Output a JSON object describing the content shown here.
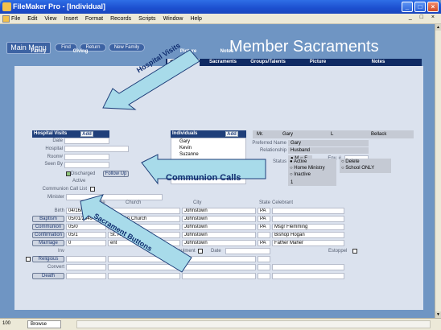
{
  "window": {
    "title": "FileMaker Pro - [Individual]",
    "min": "_",
    "max": "□",
    "close": "×"
  },
  "menubar": {
    "items": [
      "File",
      "Edit",
      "View",
      "Insert",
      "Format",
      "Records",
      "Scripts",
      "Window",
      "Help"
    ],
    "right_controls": "_ □ ×"
  },
  "toolbar": {
    "main_menu": "Main Menu",
    "find": "Find",
    "return": "Return",
    "new_family": "New Family"
  },
  "page_title": "Member Sacraments",
  "top_tabs": [
    "Family",
    "Giving",
    "Picture",
    "Notes"
  ],
  "sub_tabs": {
    "member": "< Member >",
    "sacraments": "Sacraments",
    "groups": "Groups/Talents",
    "picture": "Picture",
    "notes": "Notes"
  },
  "hospital": {
    "header": "Hospital Visits",
    "add": "Add",
    "labels": {
      "date": "Date",
      "hospital": "Hospital",
      "room": "Room#",
      "seen_by": "Seen By"
    },
    "discharged": "Discharged",
    "follow_up": "Follow Up",
    "status": "Active"
  },
  "individuals": {
    "header": "Individuals",
    "add": "Add",
    "names": [
      "Gary",
      "Kevin",
      "Suzanne"
    ]
  },
  "name_row": {
    "title": "Mr.",
    "first": "Gary",
    "middle": "L",
    "last": "Bellack"
  },
  "member_info": {
    "preferred_label": "Preferred Name",
    "preferred": "Gary",
    "relationship_label": "Relationship",
    "relationship": "Husband",
    "sex_m": "M",
    "sex_f": "F",
    "env_label": "Env. #"
  },
  "status": {
    "label": "Status",
    "options": [
      "Active",
      "Home Ministry",
      "Inactive",
      "Delete",
      "School ONLY"
    ],
    "value": "1"
  },
  "communion": {
    "call_list": "Communion Call List",
    "minister": "Minister"
  },
  "sacrament_columns": {
    "date": "Date",
    "church": "Church",
    "city": "City",
    "state": "State",
    "celebrant": "Celebrant"
  },
  "sacraments": [
    {
      "name": "Birth",
      "date": "04/16/1949",
      "church": "",
      "city": "Johnstown",
      "state": "PA",
      "celebrant": ""
    },
    {
      "name": "Baptism",
      "date": "05/01/2049",
      "church": "Visitation Church",
      "city": "Johnstown",
      "state": "PA",
      "celebrant": ""
    },
    {
      "name": "Communion",
      "date": "05/0",
      "church": "St. Andrew",
      "city": "Johnstown",
      "state": "PA",
      "celebrant": "Msgr Flemming"
    },
    {
      "name": "Confirmation",
      "date": "05/1",
      "church": "St. Andrew Church",
      "city": "Johnstown",
      "state": "",
      "celebrant": "Bishop Hogan"
    },
    {
      "name": "Marriage",
      "date": "0",
      "church": "ent",
      "city": "Johnstown",
      "state": "PA",
      "celebrant": "Father Maher"
    }
  ],
  "annulment": {
    "inv": "Inv",
    "annulment": "Annulment",
    "date": "Date",
    "estoppel": "Estoppel"
  },
  "others": [
    "Religious",
    "Convert",
    "Death"
  ],
  "callouts": {
    "hospital": "Hospital Visits",
    "communion": "Communion Calls",
    "sacrament": "Sacrament Buttons"
  },
  "statusbar": {
    "zoom": "100",
    "mode": "Browse"
  },
  "colors": {
    "dark_blue": "#1f3f7a",
    "panel": "#dbe2ee",
    "background": "#6f95c3",
    "callout": "#a8dbea"
  }
}
